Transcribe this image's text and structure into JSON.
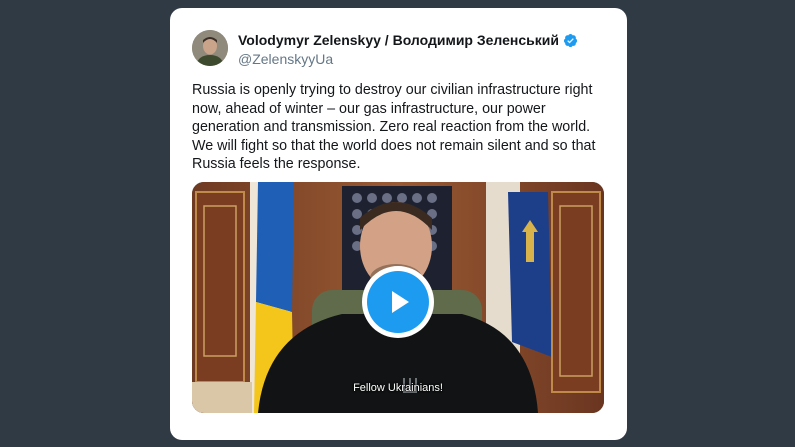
{
  "tweet": {
    "author_name": "Volodymyr Zelenskyy / Володимир Зеленський",
    "handle": "@ZelenskyyUa",
    "verified": true,
    "text": "Russia is openly trying to destroy our civilian infrastructure right now, ahead of winter – our gas infrastructure, our power generation and transmission. Zero real reaction from the world. We will fight so that the world does not remain silent and so that Russia feels the response.",
    "video": {
      "caption": "Fellow Ukrainians!",
      "play_icon": "play-icon"
    }
  },
  "colors": {
    "background": "#303a45",
    "card": "#ffffff",
    "accent": "#1d9bf0",
    "handle": "#657786",
    "text": "#14171a"
  }
}
